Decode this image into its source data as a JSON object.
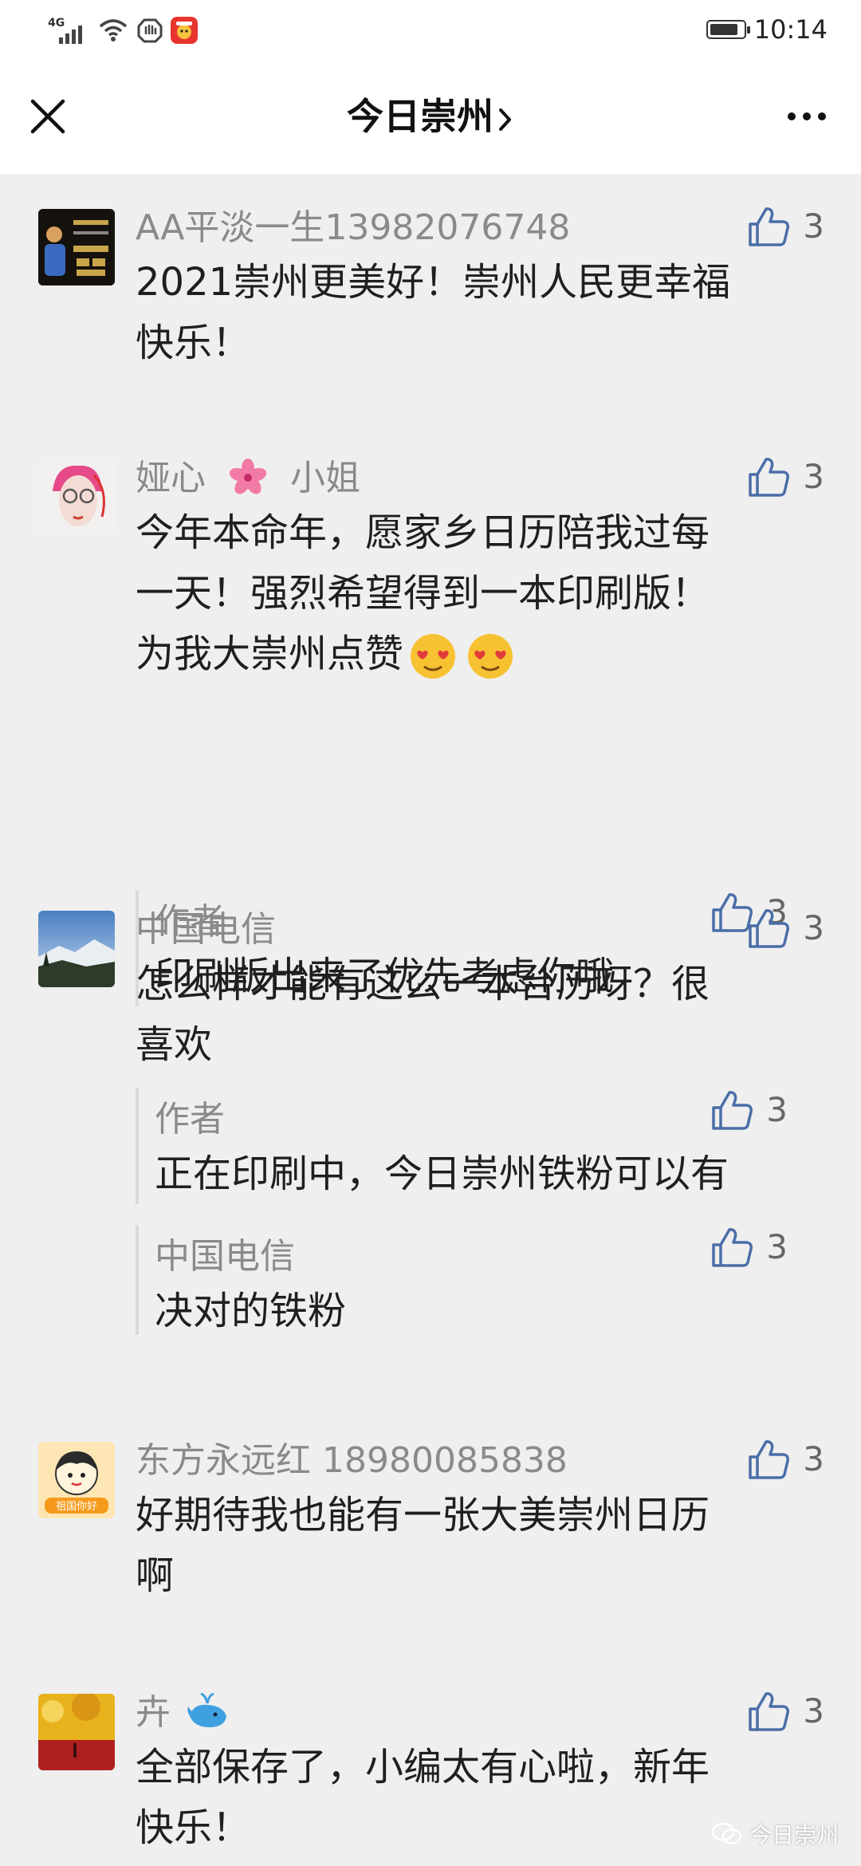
{
  "status_bar": {
    "network_label": "4G",
    "time": "10:14",
    "battery_level": 0.85
  },
  "header": {
    "title": "今日崇州",
    "close_icon": "close-icon",
    "more_icon": "more-horizontal-icon"
  },
  "comments": [
    {
      "name": "AA平淡一生13982076748",
      "text_lines": [
        "2021崇州更美好！崇州人民更幸福",
        "快乐！"
      ],
      "likes": "3"
    },
    {
      "name": "娅心",
      "name_suffix": "小姐",
      "text_lines": [
        "今年本命年，愿家乡日历陪我过每",
        "一天！强烈希望得到一本印刷版！",
        "为我大崇州点赞"
      ],
      "likes": "3",
      "reply": {
        "name": "作者",
        "text": "印刷版出来了优先考虑你哦",
        "likes": "3"
      }
    },
    {
      "name": "中国电信",
      "text_lines": [
        "怎么样才能有这么一本台历呀？很",
        "喜欢"
      ],
      "likes": "3",
      "replies": [
        {
          "name": "作者",
          "text": "正在印刷中，今日崇州铁粉可以有",
          "likes": "3"
        },
        {
          "name": "中国电信",
          "text": "决对的铁粉",
          "likes": "3"
        }
      ]
    },
    {
      "name": "东方永远红 18980085838",
      "text_lines": [
        "好期待我也能有一张大美崇州日历",
        "啊"
      ],
      "likes": "3"
    },
    {
      "name": "卉",
      "text_lines": [
        "全部保存了，小编太有心啦，新年",
        "快乐！"
      ],
      "likes": "3"
    }
  ],
  "watermark": "今日崇州",
  "colors": {
    "background": "#efefef",
    "like_icon": "#4a6ea8",
    "name_text": "#8a8a8a"
  }
}
